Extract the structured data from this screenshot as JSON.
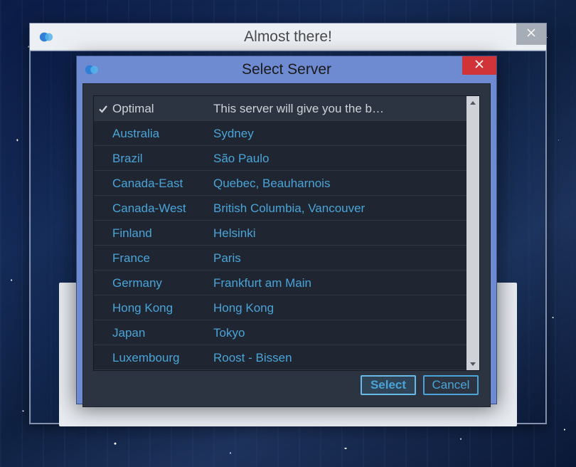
{
  "parent": {
    "title": "Almost there!",
    "close_label": "Close"
  },
  "modal": {
    "title": "Select Server",
    "close_label": "Close",
    "select_label": "Select",
    "cancel_label": "Cancel",
    "selected_index": 0,
    "servers": [
      {
        "name": "Optimal",
        "location": "This server will give you the b…"
      },
      {
        "name": "Australia",
        "location": "Sydney"
      },
      {
        "name": "Brazil",
        "location": "São Paulo"
      },
      {
        "name": "Canada-East",
        "location": "Quebec, Beauharnois"
      },
      {
        "name": "Canada-West",
        "location": "British Columbia, Vancouver"
      },
      {
        "name": "Finland",
        "location": "Helsinki"
      },
      {
        "name": "France",
        "location": "Paris"
      },
      {
        "name": "Germany",
        "location": "Frankfurt am Main"
      },
      {
        "name": "Hong Kong",
        "location": "Hong Kong"
      },
      {
        "name": "Japan",
        "location": "Tokyo"
      },
      {
        "name": "Luxembourg",
        "location": "Roost - Bissen"
      }
    ]
  }
}
